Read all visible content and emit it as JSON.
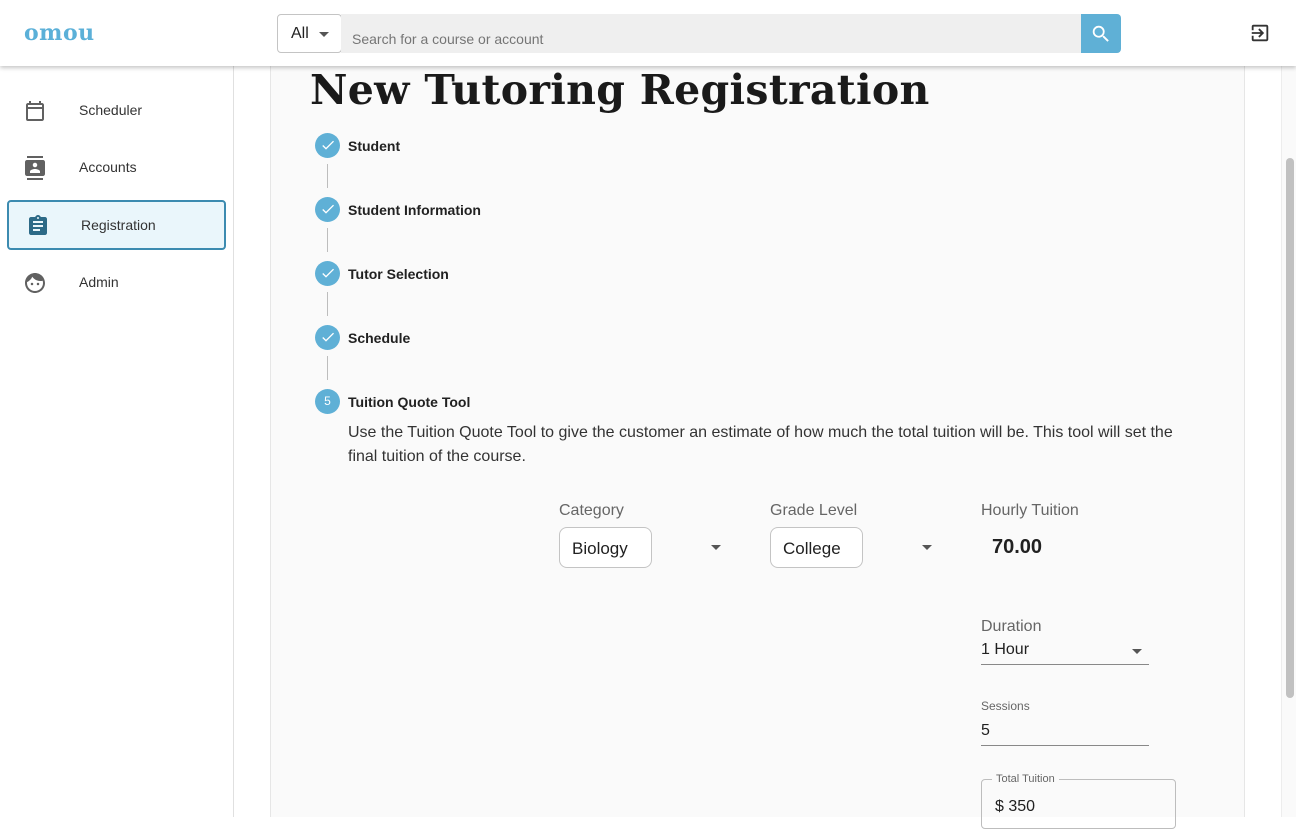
{
  "app": {
    "logo": "omou"
  },
  "search": {
    "filter_value": "All",
    "placeholder": "Search for a course or account"
  },
  "icons": {
    "search": "search-icon",
    "logout": "logout-icon",
    "scheduler": "calendar-icon",
    "accounts": "contacts-icon",
    "registration": "clipboard-icon",
    "admin": "face-icon",
    "step_done": "check-icon"
  },
  "colors": {
    "accent": "#5fb0d6",
    "brand": "#5bb0d8",
    "active_border": "#3c8bb0"
  },
  "sidebar": {
    "items": [
      {
        "label": "Scheduler",
        "active": false
      },
      {
        "label": "Accounts",
        "active": false
      },
      {
        "label": "Registration",
        "active": true
      },
      {
        "label": "Admin",
        "active": false
      }
    ]
  },
  "page": {
    "title": "New Tutoring Registration"
  },
  "steps": [
    {
      "label": "Student",
      "complete": true
    },
    {
      "label": "Student Information",
      "complete": true
    },
    {
      "label": "Tutor Selection",
      "complete": true
    },
    {
      "label": "Schedule",
      "complete": true
    },
    {
      "label": "Tuition Quote Tool",
      "complete": false,
      "number": "5"
    }
  ],
  "quote": {
    "description": "Use the Tuition Quote Tool to give the customer an estimate of how much the total tuition will be. This tool will set the final tuition of the course.",
    "category_label": "Category",
    "category_value": "Biology",
    "grade_label": "Grade Level",
    "grade_value": "College",
    "hourly_label": "Hourly Tuition",
    "hourly_value": "70.00",
    "duration_label": "Duration",
    "duration_value": "1 Hour",
    "sessions_label": "Sessions",
    "sessions_value": "5",
    "total_label": "Total Tuition",
    "total_value": "$ 350"
  }
}
